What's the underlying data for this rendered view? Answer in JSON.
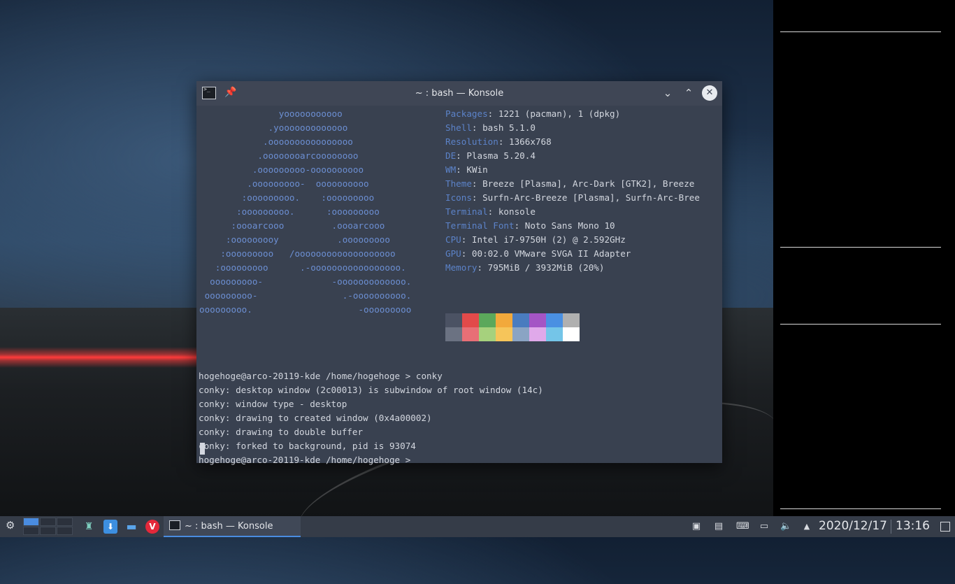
{
  "window": {
    "title": "~ : bash — Konsole"
  },
  "ascii_art": [
    "               yooooooooooo",
    "             .yooooooooooooo",
    "            .oooooooooooooooo",
    "           .oooooooarcoooooooo",
    "          .ooooooooo-oooooooooo",
    "         .ooooooooo-  oooooooooo",
    "        :ooooooooo.    :ooooooooo",
    "       :ooooooooo.      :ooooooooo",
    "      :oooarcooo         .oooarcooo",
    "     :ooooooooy           .ooooooooo",
    "    :ooooooooo   /ooooooooooooooooooo",
    "   :ooooooooo      .-ooooooooooooooooo.",
    "  ooooooooo-             -ooooooooooooo.",
    " ooooooooo-                .-oooooooooo.",
    "ooooooooo.                    -ooooooooo"
  ],
  "sysinfo": [
    {
      "key": "Packages",
      "value": ": 1221 (pacman), 1 (dpkg)"
    },
    {
      "key": "Shell",
      "value": ": bash 5.1.0"
    },
    {
      "key": "Resolution",
      "value": ": 1366x768"
    },
    {
      "key": "DE",
      "value": ": Plasma 5.20.4"
    },
    {
      "key": "WM",
      "value": ": KWin"
    },
    {
      "key": "Theme",
      "value": ": Breeze [Plasma], Arc-Dark [GTK2], Breeze"
    },
    {
      "key": "Icons",
      "value": ": Surfn-Arc-Breeze [Plasma], Surfn-Arc-Bree"
    },
    {
      "key": "Terminal",
      "value": ": konsole"
    },
    {
      "key": "Terminal Font",
      "value": ": Noto Sans Mono 10"
    },
    {
      "key": "CPU",
      "value": ": Intel i7-9750H (2) @ 2.592GHz"
    },
    {
      "key": "GPU",
      "value": ": 00:02.0 VMware SVGA II Adapter"
    },
    {
      "key": "Memory",
      "value": ": 795MiB / 3932MiB (20%)"
    }
  ],
  "palette": {
    "row1": [
      "#4b5263",
      "#e24a4a",
      "#5ba85b",
      "#f2a93b",
      "#4a7cbf",
      "#a455c5",
      "#4a90e2",
      "#b0b0b0"
    ],
    "row2": [
      "#6b7282",
      "#e86f76",
      "#a6d17d",
      "#f6c55a",
      "#8aa4c4",
      "#e0a9ea",
      "#74c5e8",
      "#ffffff"
    ]
  },
  "output": [
    "hogehoge@arco-20119-kde /home/hogehoge > conky",
    "conky: desktop window (2c00013) is subwindow of root window (14c)",
    "conky: window type - desktop",
    "conky: drawing to created window (0x4a00002)",
    "conky: drawing to double buffer",
    "conky: forked to background, pid is 93074",
    "hogehoge@arco-20119-kde /home/hogehoge >"
  ],
  "taskbar": {
    "task_label": "~ : bash — Konsole",
    "date": "2020/12/17",
    "time": "13:16"
  }
}
